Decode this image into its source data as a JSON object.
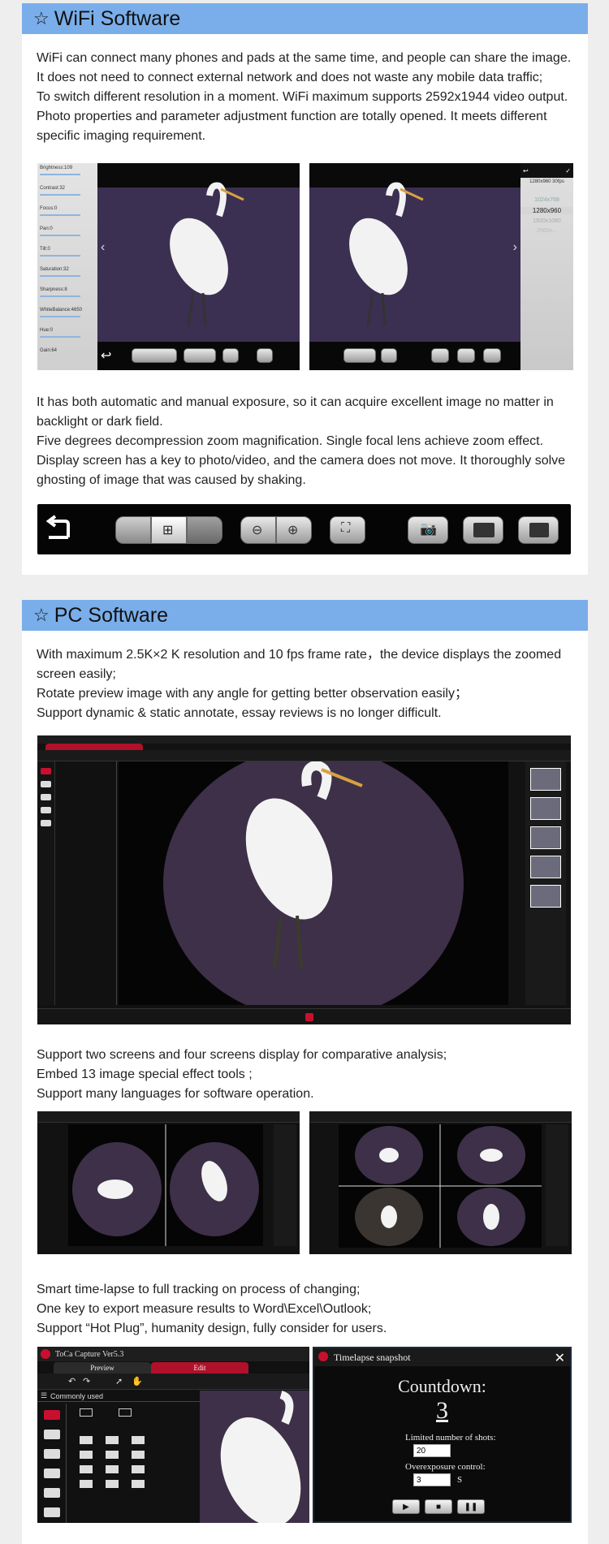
{
  "wifi": {
    "title": "WiFi Software",
    "para1": [
      "WiFi can connect many phones and pads at the same time, and people can share the image.",
      "It does not need to connect external network and does not waste any mobile data traffic;",
      "To switch different resolution in a moment. WiFi maximum supports 2592x1944 video output.",
      "Photo properties and parameter adjustment function are totally opened. It meets different",
      "specific imaging requirement."
    ],
    "left_panel": {
      "sliders": [
        "Brightness:109",
        "Contrast:32",
        "Focus:0",
        "Pan:0",
        "Tilt:0",
        "Saturation:32",
        "Sharpness:8",
        "WhiteBalance:4650",
        "Hue:0",
        "Gain:64"
      ]
    },
    "right_panel": {
      "resolutions_header": "1280x960 30fps",
      "resolutions": [
        "1024x768",
        "1280x960",
        "1920x1080",
        "2560x..."
      ]
    },
    "para2": [
      "It has both automatic and manual exposure, so it can acquire excellent image no matter in",
      "backlight or dark field.",
      "Five degrees decompression zoom magnification. Single focal lens achieve zoom effect.",
      "Display screen has a key to photo/video, and the camera does not move. It thoroughly solve",
      "ghosting of image that was caused by shaking."
    ]
  },
  "pc": {
    "title": "PC Software",
    "para1": [
      "With maximum 2.5K×2 K resolution and 10 fps frame rate，the device  displays the zoomed",
      "screen easily;",
      "Rotate preview image with any angle for getting better observation easily；",
      "Support dynamic & static annotate, essay reviews is no longer difficult."
    ],
    "para2": [
      "Support two screens and four screens display for comparative analysis;",
      "Embed 13 image special effect tools ;",
      "Support many languages for software operation."
    ],
    "para3": [
      "Smart time-lapse to full tracking on process of changing;",
      "One key to export measure results to Word\\Excel\\Outlook;",
      "Support “Hot Plug”, humanity design, fully consider for users."
    ],
    "capture_app": {
      "title": "ToCa Capture Ver5.3",
      "tab_preview": "Preview",
      "tab_edit": "Edit",
      "sidebar_label": "Commonly used"
    },
    "timelapse": {
      "title": "Timelapse snapshot",
      "close": "✕",
      "countdown_label": "Countdown:",
      "countdown_value": "3",
      "limited_label": "Limited number of shots:",
      "limited_value": "20",
      "overexposure_label": "Overexposure control:",
      "overexposure_value": "3",
      "overexposure_unit": "S"
    }
  },
  "colors": {
    "header": "#7aaeea",
    "page_bg": "#eeeeee",
    "panel_bg": "#ffffff",
    "accent_red": "#c8102e"
  }
}
